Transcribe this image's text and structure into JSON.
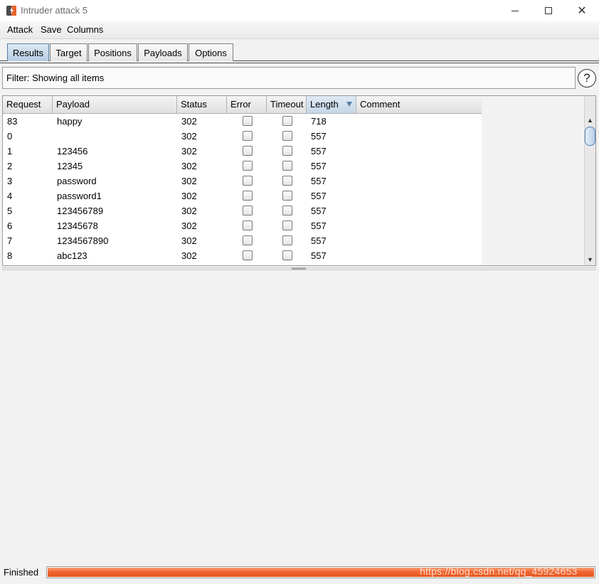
{
  "window": {
    "title": "Intruder attack 5",
    "controls": {
      "minimize": "minimize-icon",
      "maximize": "maximize-icon",
      "close": "close-icon"
    }
  },
  "menu": {
    "attack": "Attack",
    "save": "Save",
    "columns": "Columns"
  },
  "tabs": [
    {
      "label": "Results",
      "active": true
    },
    {
      "label": "Target",
      "active": false
    },
    {
      "label": "Positions",
      "active": false
    },
    {
      "label": "Payloads",
      "active": false
    },
    {
      "label": "Options",
      "active": false
    }
  ],
  "filter": {
    "text": "Filter: Showing all items",
    "help": "?"
  },
  "table": {
    "columns": [
      "Request",
      "Payload",
      "Status",
      "Error",
      "Timeout",
      "Length",
      "Comment"
    ],
    "sorted_column": "Length",
    "rows": [
      {
        "request": "83",
        "payload": "happy",
        "status": "302",
        "error": false,
        "timeout": false,
        "length": "718",
        "comment": ""
      },
      {
        "request": "0",
        "payload": "",
        "status": "302",
        "error": false,
        "timeout": false,
        "length": "557",
        "comment": ""
      },
      {
        "request": "1",
        "payload": "123456",
        "status": "302",
        "error": false,
        "timeout": false,
        "length": "557",
        "comment": ""
      },
      {
        "request": "2",
        "payload": "12345",
        "status": "302",
        "error": false,
        "timeout": false,
        "length": "557",
        "comment": ""
      },
      {
        "request": "3",
        "payload": "password",
        "status": "302",
        "error": false,
        "timeout": false,
        "length": "557",
        "comment": ""
      },
      {
        "request": "4",
        "payload": "password1",
        "status": "302",
        "error": false,
        "timeout": false,
        "length": "557",
        "comment": ""
      },
      {
        "request": "5",
        "payload": "123456789",
        "status": "302",
        "error": false,
        "timeout": false,
        "length": "557",
        "comment": ""
      },
      {
        "request": "6",
        "payload": "12345678",
        "status": "302",
        "error": false,
        "timeout": false,
        "length": "557",
        "comment": ""
      },
      {
        "request": "7",
        "payload": "1234567890",
        "status": "302",
        "error": false,
        "timeout": false,
        "length": "557",
        "comment": ""
      },
      {
        "request": "8",
        "payload": "abc123",
        "status": "302",
        "error": false,
        "timeout": false,
        "length": "557",
        "comment": ""
      }
    ]
  },
  "status": {
    "label": "Finished",
    "progress": 1.0,
    "progress_color": "#f0652f"
  },
  "watermark": "https://blog.csdn.net/qq_45924653",
  "colors": {
    "active_tab": "#b5cde2",
    "sorted_header": "#c5d7e8",
    "progress": "#f0652f"
  }
}
